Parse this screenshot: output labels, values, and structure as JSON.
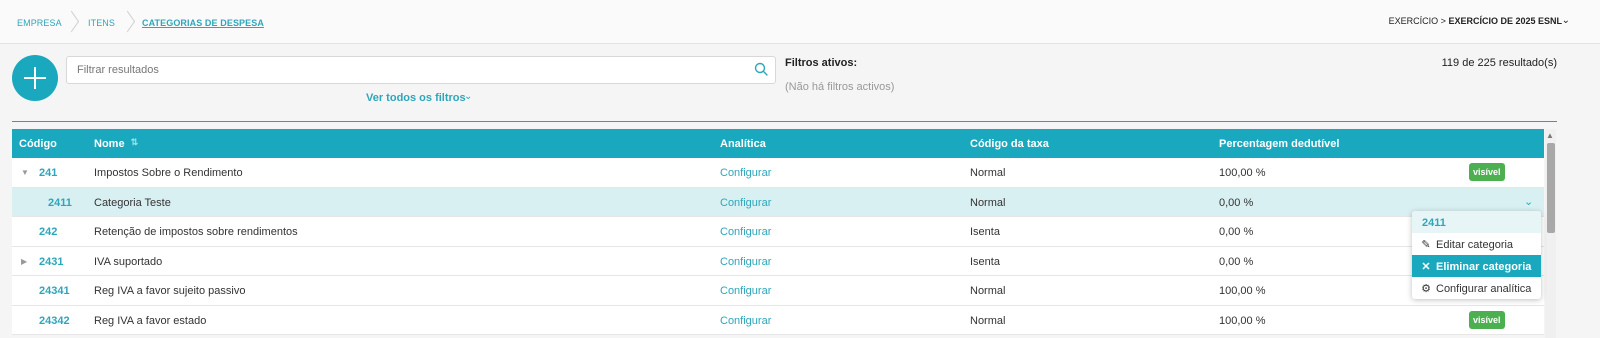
{
  "breadcrumb": {
    "items": [
      "EMPRESA",
      "ITENS",
      "CATEGORIAS DE DESPESA"
    ]
  },
  "exercise": {
    "prefix": "EXERCÍCIO >",
    "value": "EXERCÍCIO DE 2025 ESNL"
  },
  "toolbar": {
    "search_placeholder": "Filtrar resultados",
    "all_filters_label": "Ver todos os filtros",
    "filters_title": "Filtros ativos:",
    "filters_none": "(Não há filtros activos)",
    "results": "119 de 225 resultado(s)"
  },
  "table": {
    "headers": [
      "Código",
      "Nome",
      "Analítica",
      "Código da taxa",
      "Percentagem dedutível"
    ],
    "rows": [
      {
        "code": "241",
        "name": "Impostos Sobre o Rendimento",
        "analytic": "Configurar",
        "tax": "Normal",
        "pct": "100,00 %",
        "badge": "visível"
      },
      {
        "code": "2411",
        "name": "Categoria Teste",
        "analytic": "Configurar",
        "tax": "Normal",
        "pct": "0,00 %",
        "badge": ""
      },
      {
        "code": "242",
        "name": "Retenção de impostos sobre rendimentos",
        "analytic": "Configurar",
        "tax": "Isenta",
        "pct": "0,00 %",
        "badge": ""
      },
      {
        "code": "2431",
        "name": "IVA suportado",
        "analytic": "Configurar",
        "tax": "Isenta",
        "pct": "0,00 %",
        "badge": ""
      },
      {
        "code": "24341",
        "name": "Reg IVA a favor sujeito passivo",
        "analytic": "Configurar",
        "tax": "Normal",
        "pct": "100,00 %",
        "badge": ""
      },
      {
        "code": "24342",
        "name": "Reg IVA a favor estado",
        "analytic": "Configurar",
        "tax": "Normal",
        "pct": "100,00 %",
        "badge": "visível"
      }
    ]
  },
  "context_menu": {
    "title": "2411",
    "items": [
      "Editar categoria",
      "Eliminar categoria",
      "Configurar analítica"
    ]
  },
  "colors": {
    "accent": "#1aa8bf",
    "badge": "#4caf50",
    "selected_row": "#d9f0f2"
  }
}
